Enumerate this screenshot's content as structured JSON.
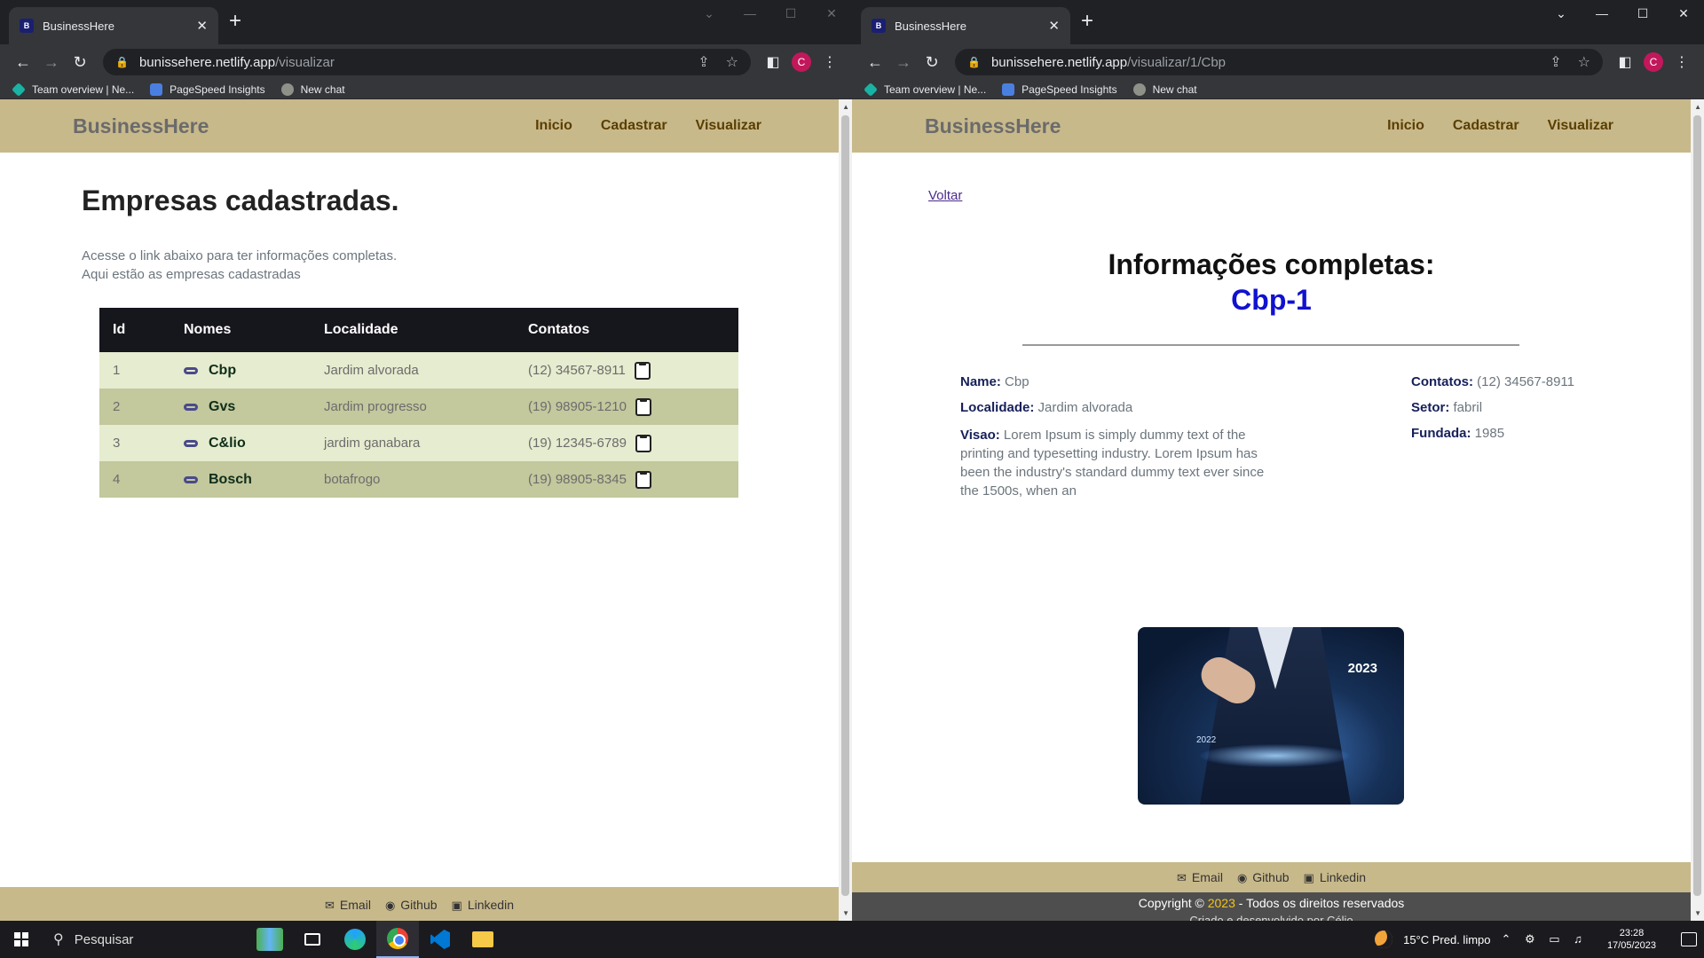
{
  "left": {
    "tab": {
      "title": "BusinessHere",
      "close": "✕",
      "new_tab": "+"
    },
    "url": {
      "host": "bunissehere.netlify.app",
      "path": "/visualizar"
    },
    "bookmarks": [
      "Team overview | Ne...",
      "PageSpeed Insights",
      "New chat"
    ],
    "profile_initial": "C",
    "site": {
      "brand": "BusinessHere",
      "nav": [
        "Inicio",
        "Cadastrar",
        "Visualizar"
      ]
    },
    "page": {
      "title": "Empresas cadastradas.",
      "lead1": "Acesse o link abaixo para ter informações completas.",
      "lead2": "Aqui estão as empresas cadastradas",
      "columns": [
        "Id",
        "Nomes",
        "Localidade",
        "Contatos"
      ],
      "rows": [
        {
          "id": "1",
          "name": "Cbp",
          "local": "Jardim alvorada",
          "contact": "(12) 34567-8911"
        },
        {
          "id": "2",
          "name": "Gvs",
          "local": "Jardim progresso",
          "contact": "(19) 98905-1210"
        },
        {
          "id": "3",
          "name": "C&lio",
          "local": "jardim ganabara",
          "contact": "(19) 12345-6789"
        },
        {
          "id": "4",
          "name": "Bosch",
          "local": "botafrogo",
          "contact": "(19) 98905-8345"
        }
      ]
    },
    "footer": {
      "email": "Email",
      "github": "Github",
      "linkedin": "Linkedin"
    }
  },
  "right": {
    "tab": {
      "title": "BusinessHere",
      "close": "✕",
      "new_tab": "+"
    },
    "url": {
      "host": "bunissehere.netlify.app",
      "path": "/visualizar/1/Cbp"
    },
    "bookmarks": [
      "Team overview | Ne...",
      "PageSpeed Insights",
      "New chat"
    ],
    "profile_initial": "C",
    "site": {
      "brand": "BusinessHere",
      "nav": [
        "Inicio",
        "Cadastrar",
        "Visualizar"
      ]
    },
    "page": {
      "back": "Voltar",
      "heading": "Informações completas:",
      "company": "Cbp-1",
      "name_label": "Name:",
      "name_value": "Cbp",
      "local_label": "Localidade:",
      "local_value": "Jardim alvorada",
      "visao_label": "Visao:",
      "visao_value": "Lorem Ipsum is simply dummy text of the printing and typesetting industry. Lorem Ipsum has been the industry's standard dummy text ever since the 1500s, when an",
      "contatos_label": "Contatos:",
      "contatos_value": "(12) 34567-8911",
      "setor_label": "Setor:",
      "setor_value": "fabril",
      "fundada_label": "Fundada:",
      "fundada_value": "1985",
      "image_year_top": "2023",
      "image_year_low": "2022"
    },
    "footer": {
      "email": "Email",
      "github": "Github",
      "linkedin": "Linkedin"
    },
    "copyright": {
      "prefix": "Copyright © ",
      "year": "2023",
      "suffix": " - Todos os direitos reservados",
      "line2": "Criado e desenvolvido por Célio"
    }
  },
  "taskbar": {
    "search_placeholder": "Pesquisar",
    "weather": "15°C  Pred. limpo",
    "time": "23:28",
    "date": "17/05/2023"
  },
  "colors": {
    "nav_bg": "#c8b98b",
    "table_header": "#16161d",
    "row_light": "#e6eccf",
    "row_dark": "#c3c89d",
    "company_name": "#1111d0",
    "copyright_year": "#f5c21b"
  }
}
